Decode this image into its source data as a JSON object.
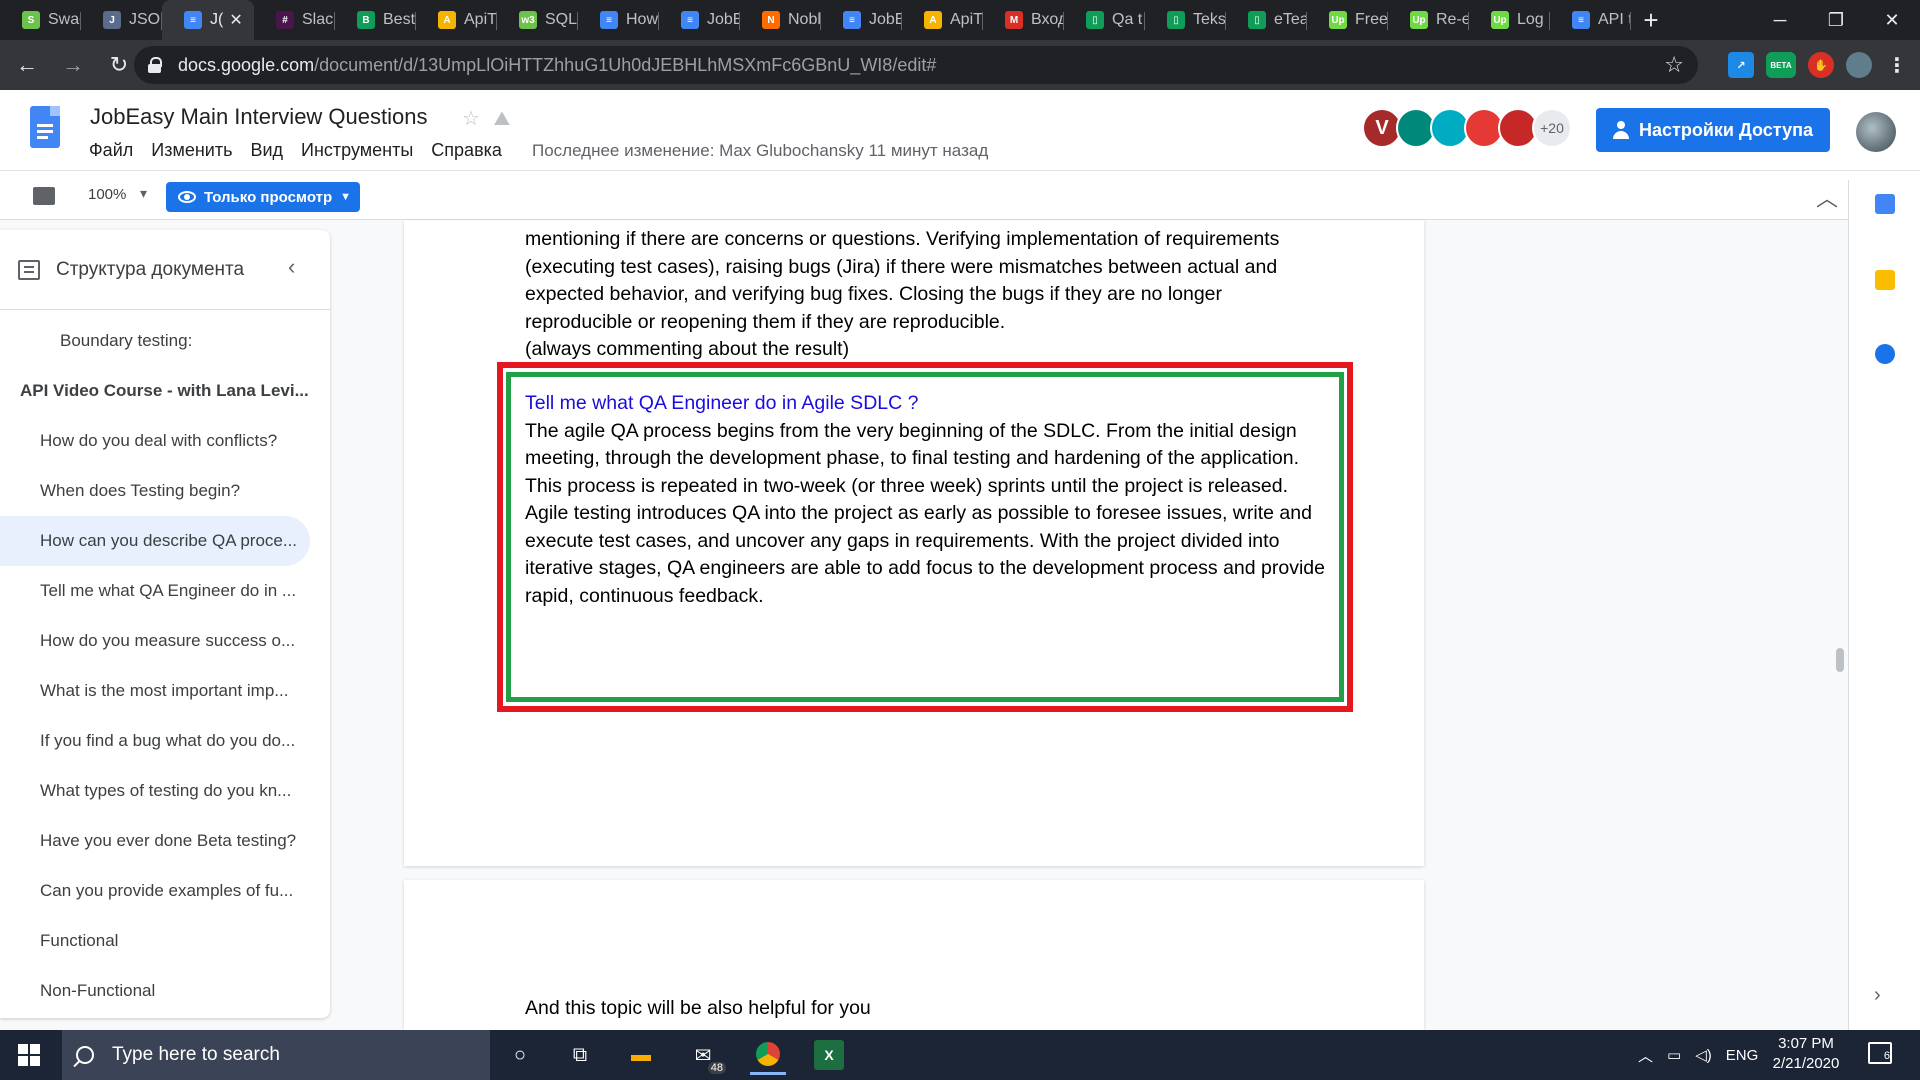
{
  "browser": {
    "tabs": [
      {
        "title": "Swag",
        "color": "#6cc24a",
        "glyph": "S"
      },
      {
        "title": "JSON",
        "color": "#5b6b8c",
        "glyph": "J"
      },
      {
        "title": "J(",
        "color": "#4285f4",
        "glyph": "≡",
        "active": true
      },
      {
        "title": "Slack",
        "color": "#4a154b",
        "glyph": "#"
      },
      {
        "title": "Best",
        "color": "#0f9d58",
        "glyph": "B"
      },
      {
        "title": "ApiT",
        "color": "#f4b400",
        "glyph": "A"
      },
      {
        "title": "SQL",
        "color": "#6cc24a",
        "glyph": "w3"
      },
      {
        "title": "How",
        "color": "#4285f4",
        "glyph": "≡"
      },
      {
        "title": "JobE",
        "color": "#4285f4",
        "glyph": "≡"
      },
      {
        "title": "Nobl",
        "color": "#ff6d00",
        "glyph": "N"
      },
      {
        "title": "JobE",
        "color": "#4285f4",
        "glyph": "≡"
      },
      {
        "title": "ApiT",
        "color": "#f4b400",
        "glyph": "A"
      },
      {
        "title": "Вход",
        "color": "#d93025",
        "glyph": "M"
      },
      {
        "title": "Qa t",
        "color": "#0f9d58",
        "glyph": "▯"
      },
      {
        "title": "Tekst",
        "color": "#0f9d58",
        "glyph": "▯"
      },
      {
        "title": "eTea",
        "color": "#0f9d58",
        "glyph": "▯"
      },
      {
        "title": "Freel",
        "color": "#6fda44",
        "glyph": "Up"
      },
      {
        "title": "Re-e",
        "color": "#6fda44",
        "glyph": "Up"
      },
      {
        "title": "Log",
        "color": "#6fda44",
        "glyph": "Up"
      },
      {
        "title": "API t",
        "color": "#4285f4",
        "glyph": "≡"
      }
    ],
    "new_tab": "+",
    "url_host": "docs.google.com",
    "url_path": "/document/d/13UmpLlOiHTTZhhuG1Uh0dJEBHLhMSXmFc6GBnU_WI8/edit#",
    "ext_beta": "BETA"
  },
  "docs": {
    "title": "JobEasy Main Interview Questions",
    "menu": [
      "Файл",
      "Изменить",
      "Вид",
      "Инструменты",
      "Справка"
    ],
    "last_edit": "Последнее изменение: Max Glubochansky 11 минут назад",
    "avatars": [
      {
        "letter": "V",
        "color": "#a52a2a"
      },
      {
        "letter": "",
        "color": "#00897b"
      },
      {
        "letter": "",
        "color": "#00acc1"
      },
      {
        "letter": "",
        "color": "#e53935"
      },
      {
        "letter": "",
        "color": "#c62828"
      }
    ],
    "more_users": "+20",
    "share_label": "Настройки Доступа",
    "zoom": "100%",
    "mode_label": "Только просмотр"
  },
  "outline": {
    "title": "Структура документа",
    "items": [
      {
        "text": "Boundary testing:",
        "level": 3
      },
      {
        "text": "API Video Course - with Lana Levi...",
        "level": 1
      },
      {
        "text": "How do you deal with conflicts?",
        "level": 2
      },
      {
        "text": "When does Testing begin?",
        "level": 2
      },
      {
        "text": "How can you describe QA proce...",
        "level": 2,
        "selected": true
      },
      {
        "text": "Tell me what QA Engineer do in ...",
        "level": 2
      },
      {
        "text": "How do you measure success o...",
        "level": 2
      },
      {
        "text": "What is the most important imp...",
        "level": 2
      },
      {
        "text": "If you find a bug what do you do...",
        "level": 2
      },
      {
        "text": "What types of testing do you kn...",
        "level": 2
      },
      {
        "text": "Have you ever done Beta testing?",
        "level": 2
      },
      {
        "text": "Can you provide examples of fu...",
        "level": 2
      },
      {
        "text": "Functional",
        "level": 2
      },
      {
        "text": "Non-Functional",
        "level": 2
      }
    ]
  },
  "document": {
    "top_paragraph": "mentioning if there are concerns or questions. Verifying implementation of requirements (executing test cases), raising bugs (Jira) if there were mismatches between actual and expected behavior, and verifying bug fixes. Closing the bugs if they are no longer reproducible or reopening them if they are reproducible.",
    "top_note": "(always commenting about the result)",
    "question": "Tell me what QA Engineer do in Agile SDLC ?",
    "answer_1": "The agile QA process begins from the very beginning of the SDLC. From the initial design meeting, through the development phase, to final testing and hardening of the application.",
    "answer_2": "This process is repeated in two-week (or three week) sprints until the project is released.",
    "answer_3": "Agile testing introduces QA into the project as early as possible to foresee issues, write and execute test cases, and uncover any gaps in requirements. With the project divided into iterative stages, QA engineers are able to add focus to the development process and provide rapid, continuous feedback.",
    "page2_text": "And this topic will be also helpful for you"
  },
  "taskbar": {
    "search_placeholder": "Type here to search",
    "mail_badge": "48",
    "lang": "ENG",
    "time": "3:07 PM",
    "date": "2/21/2020",
    "notif_count": "6"
  },
  "colors": {
    "red_frame": "#e3191f",
    "green_frame": "#21a047",
    "question_link": "#1a0dde",
    "accent": "#1a73e8"
  }
}
